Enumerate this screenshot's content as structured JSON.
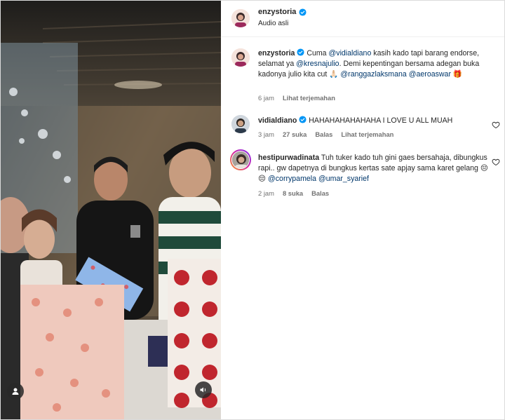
{
  "header": {
    "username": "enzystoria",
    "subtitle": "Audio asli"
  },
  "caption": {
    "username": "enzystoria",
    "parts": [
      {
        "text": "Cuma ",
        "mention": false
      },
      {
        "text": "@vidialdiano",
        "mention": true
      },
      {
        "text": " kasih kado tapi barang endorse, selamat ya ",
        "mention": false
      },
      {
        "text": "@kresnajulio",
        "mention": true
      },
      {
        "text": ". Demi kepentingan bersama adegan buka kadonya julio kita cut 🙏🏻 ",
        "mention": false
      },
      {
        "text": "@ranggazlaksmana",
        "mention": true
      },
      {
        "text": " ",
        "mention": false
      },
      {
        "text": "@aeroaswar",
        "mention": true
      },
      {
        "text": " 🎁",
        "mention": false
      }
    ],
    "time": "6 jam",
    "translate": "Lihat terjemahan"
  },
  "comments": [
    {
      "username": "vidialdiano",
      "text": "HAHAHAHAHAHAHA I LOVE U ALL MUAH",
      "time": "3 jam",
      "likes": "27 suka",
      "reply": "Balas",
      "translate": "Lihat terjemahan"
    },
    {
      "username": "hestipurwadinata",
      "text_parts": [
        {
          "text": "Tuh tuker kado tuh gini gaes bersahaja, dibungkus rapi.. gw dapetnya di bungkus kertas sate apjay sama karet gelang 😔😔 ",
          "mention": false
        },
        {
          "text": "@corrypamela",
          "mention": true
        },
        {
          "text": " ",
          "mention": false
        },
        {
          "text": "@umar_syarief",
          "mention": true
        }
      ],
      "time": "2 jam",
      "likes": "8 suka",
      "reply": "Balas"
    }
  ],
  "icons": {
    "verified": "verified-badge-icon",
    "heart": "heart-outline-icon",
    "user": "user-tag-icon",
    "mute": "audio-icon"
  },
  "colors": {
    "verified": "#0095f6",
    "mention": "#00376b",
    "muted_text": "#737373",
    "story_ring": "#d6249f"
  }
}
